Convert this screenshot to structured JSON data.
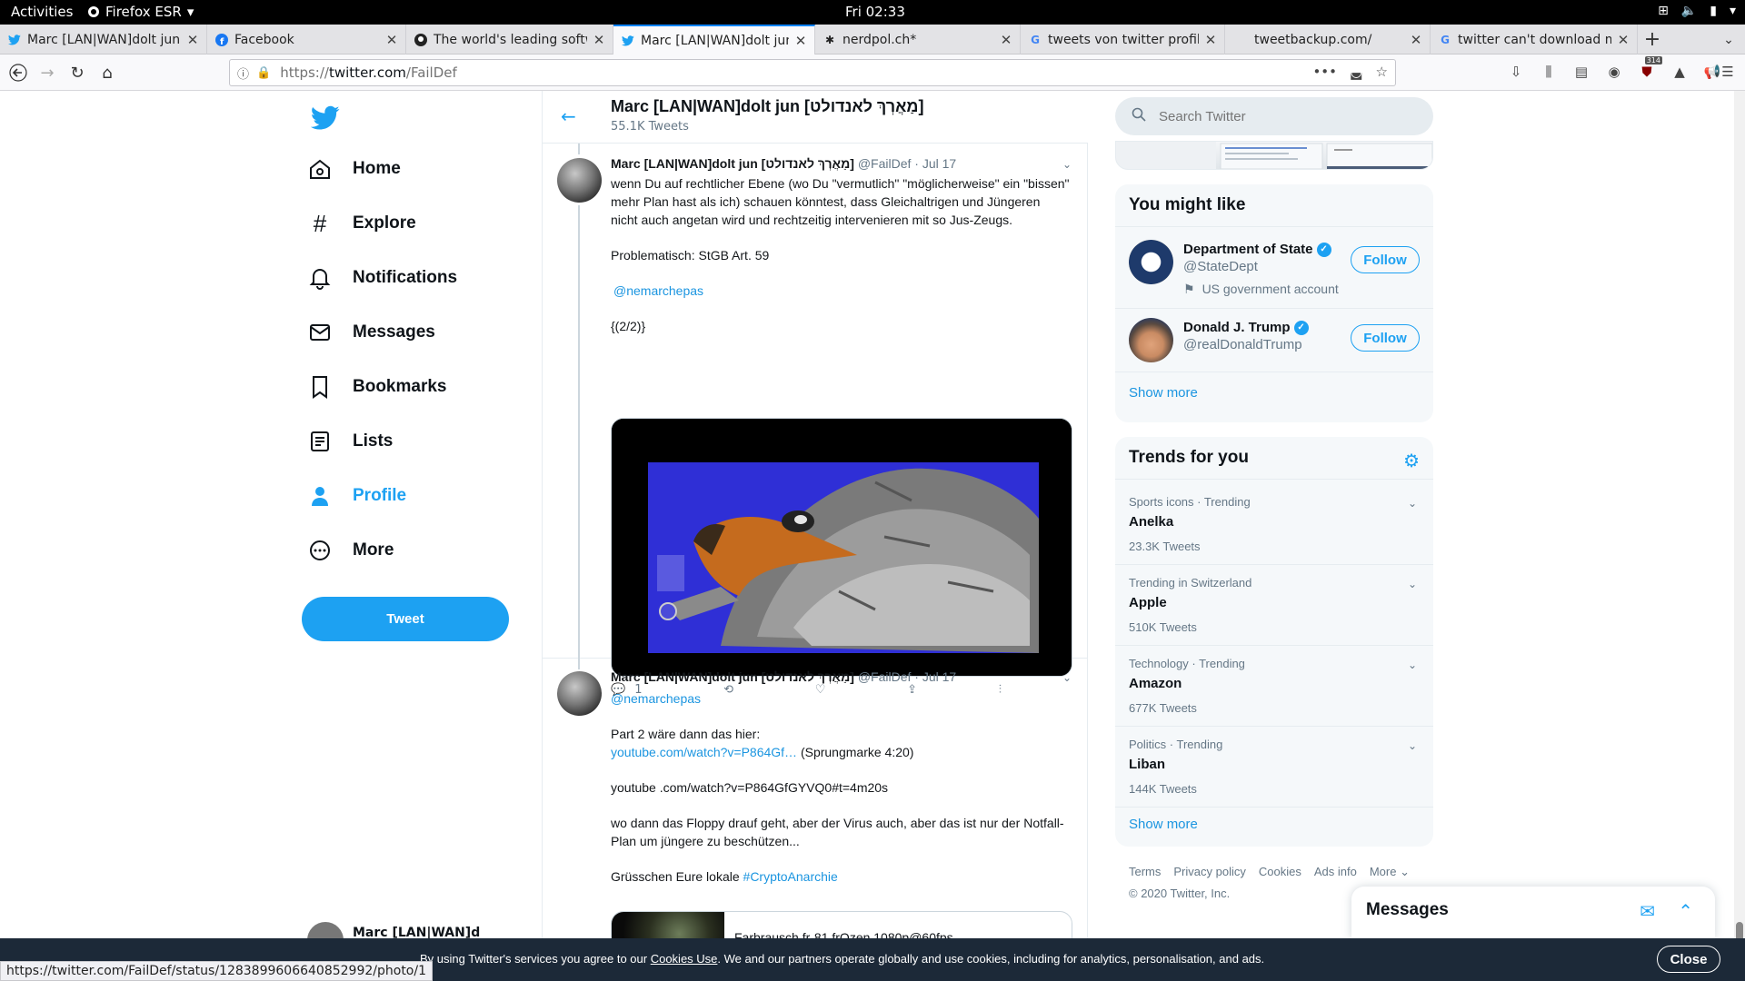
{
  "topbar": {
    "activities": "Activities",
    "app": "Firefox ESR",
    "clock": "Fri 02:33"
  },
  "tabs": [
    {
      "title": "Marc [LAN|WAN]dolt jun",
      "icon": "twitter-icon"
    },
    {
      "title": "Facebook",
      "icon": "facebook-icon"
    },
    {
      "title": "The world's leading softw",
      "icon": "github-icon"
    },
    {
      "title": "Marc [LAN|WAN]dolt jun",
      "icon": "twitter-icon",
      "active": true
    },
    {
      "title": "nerdpol.ch*",
      "icon": "diaspora-icon"
    },
    {
      "title": "tweets von twitter profil",
      "icon": "google-icon"
    },
    {
      "title": "tweetbackup.com/",
      "icon": ""
    },
    {
      "title": "twitter can't download m",
      "icon": "google-icon"
    }
  ],
  "navbar": {
    "url_prefix": "https://",
    "url_host": "twitter.com",
    "url_path": "/FailDef",
    "badge_count": "314"
  },
  "sidebar": {
    "items": [
      {
        "label": "Home",
        "icon": "home-icon"
      },
      {
        "label": "Explore",
        "icon": "hashtag-icon"
      },
      {
        "label": "Notifications",
        "icon": "bell-icon"
      },
      {
        "label": "Messages",
        "icon": "envelope-icon"
      },
      {
        "label": "Bookmarks",
        "icon": "bookmark-icon"
      },
      {
        "label": "Lists",
        "icon": "list-icon"
      },
      {
        "label": "Profile",
        "icon": "person-icon"
      },
      {
        "label": "More",
        "icon": "more-circle-icon"
      }
    ],
    "tweet_button": "Tweet",
    "account_name": "Marc [LAN|WAN]d"
  },
  "profile_header": {
    "name": "Marc [LAN|WAN]dolt jun [מַאֲרְךְ לאנדולט]",
    "tweet_count": "55.1K Tweets"
  },
  "tweets": [
    {
      "name": "Marc [LAN|WAN]dolt jun [מַאֲרְךְ לאנדולט]",
      "handle": "@FailDef",
      "date": "Jul 17",
      "text1": "wenn Du auf rechtlicher Ebene (wo Du \"vermutlich\" \"möglicherweise\" ein \"bissen\" mehr Plan hast als ich) schauen könntest, dass Gleichaltrigen und Jüngeren nicht auch angetan wird und rechtzeitig intervenieren mit so Jus-Zeugs.",
      "text2": "Problematisch: StGB Art. 59",
      "mention": "@nemarchepas",
      "text3": "{(2/2)}",
      "reply_count": "1"
    },
    {
      "name": "Marc [LAN|WAN]dolt jun [מַאֲרְךְ לאנדולט]",
      "handle": "@FailDef",
      "date": "Jul 17",
      "mention": "@nemarchepas",
      "line1": "Part 2 wäre dann das hier:",
      "link": "youtube.com/watch?v=P864Gf…",
      "link_suffix": " (Sprungmarke 4:20)",
      "line2": "youtube .com/watch?v=P864GfGYVQ0#t=4m20s",
      "line3": "wo dann das Floppy drauf geht, aber der Virus auch, aber das ist nur der Notfall-Plan um jüngere zu beschützen...",
      "line4_prefix": "Grüsschen Eure lokale ",
      "hashtag": "#CryptoAnarchie",
      "card_title": "Farbrausch fr-81 frOzen 1080p@60fps"
    }
  ],
  "search": {
    "placeholder": "Search Twitter"
  },
  "you_might_like": {
    "title": "You might like",
    "accounts": [
      {
        "name": "Department of State",
        "handle": "@StateDept",
        "note": "US government account",
        "follow": "Follow"
      },
      {
        "name": "Donald J. Trump",
        "handle": "@realDonaldTrump",
        "follow": "Follow"
      }
    ],
    "show_more": "Show more"
  },
  "trends": {
    "title": "Trends for you",
    "items": [
      {
        "context": "Sports icons · Trending",
        "name": "Anelka",
        "count": "23.3K Tweets"
      },
      {
        "context": "Trending in Switzerland",
        "name": "Apple",
        "count": "510K Tweets"
      },
      {
        "context": "Technology · Trending",
        "name": "Amazon",
        "count": "677K Tweets"
      },
      {
        "context": "Politics · Trending",
        "name": "Liban",
        "count": "144K Tweets"
      }
    ],
    "show_more": "Show more"
  },
  "footer": {
    "links": [
      "Terms",
      "Privacy policy",
      "Cookies",
      "Ads info",
      "More"
    ],
    "copyright": "© 2020 Twitter, Inc."
  },
  "messages_drawer": {
    "title": "Messages"
  },
  "cookie_banner": {
    "prefix": "By using Twitter's services you agree to our ",
    "link": "Cookies Use",
    "suffix": ". We and our partners operate globally and use cookies, including for analytics, personalisation, and ads.",
    "close": "Close"
  },
  "status_url": "https://twitter.com/FailDef/status/1283899606640852992/photo/1",
  "colors": {
    "twitter_blue": "#1da1f2",
    "link": "#1b95e0",
    "banner": "#1c2938"
  }
}
